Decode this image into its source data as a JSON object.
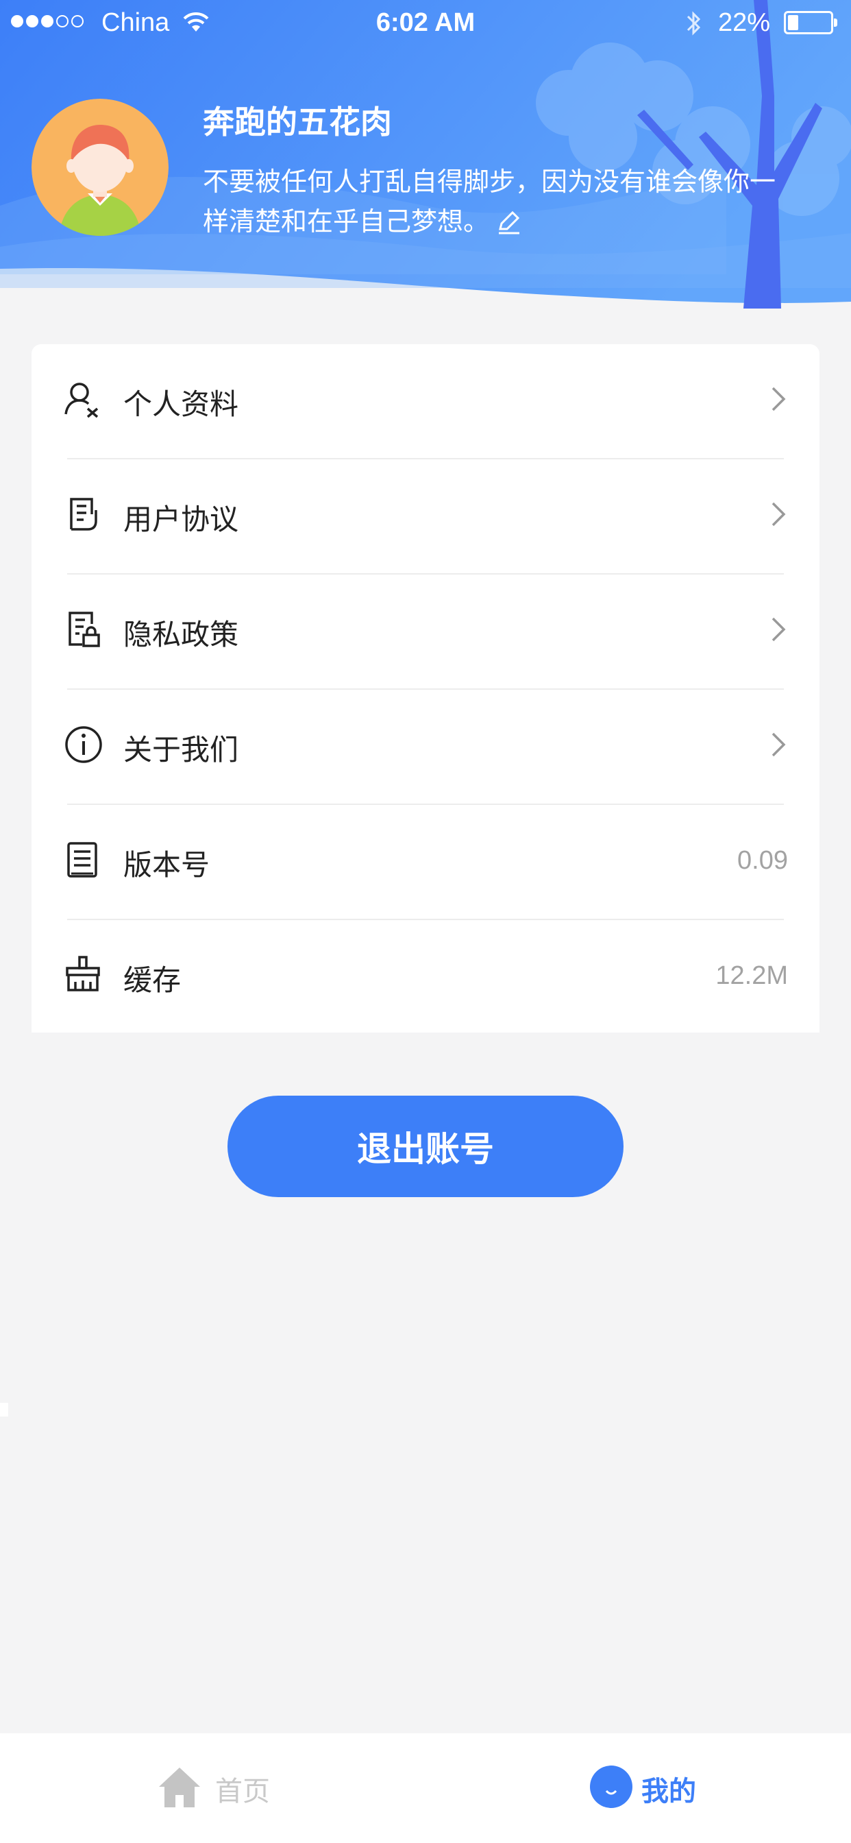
{
  "status_bar": {
    "carrier": "China",
    "time": "6:02 AM",
    "battery": "22%",
    "battery_level": 0.22
  },
  "profile": {
    "name": "奔跑的五花肉",
    "signature": "不要被任何人打乱自得脚步，因为没有谁会像你一样清楚和在乎自己梦想。"
  },
  "menu": [
    {
      "label": "个人资料",
      "icon": "person-icon",
      "arrow": true
    },
    {
      "label": "用户协议",
      "icon": "document-icon",
      "arrow": true
    },
    {
      "label": "隐私政策",
      "icon": "privacy-doc-icon",
      "arrow": true
    },
    {
      "label": "关于我们",
      "icon": "info-icon",
      "arrow": true
    },
    {
      "label": "版本号",
      "icon": "version-list-icon",
      "value": "0.09"
    },
    {
      "label": "缓存",
      "icon": "broom-icon",
      "value": "12.2M"
    }
  ],
  "logout_label": "退出账号",
  "tabbar": {
    "home": "首页",
    "mine": "我的",
    "active": "mine"
  },
  "colors": {
    "primary": "#3d7ff8",
    "header_gradient_start": "#3d7ff8",
    "header_gradient_end": "#6aaefb",
    "background": "#f4f4f5"
  }
}
